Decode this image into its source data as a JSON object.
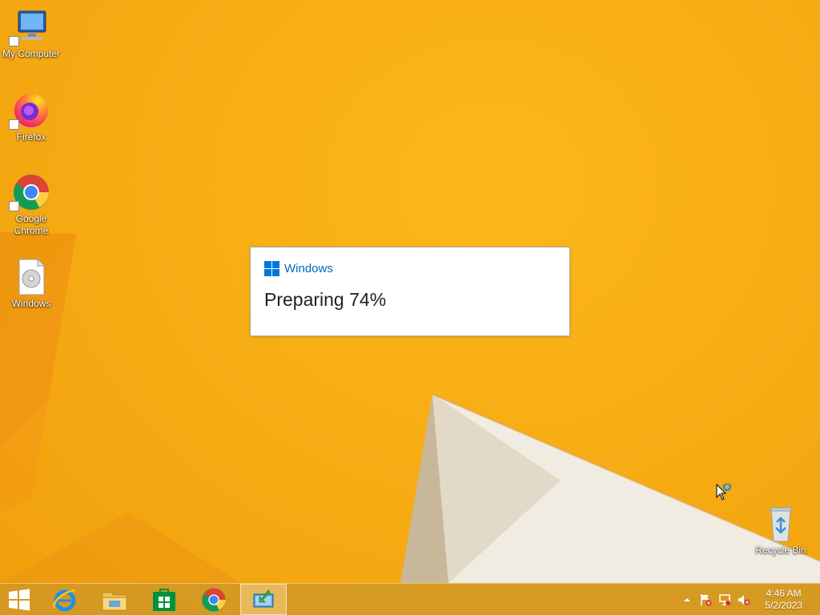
{
  "desktop": {
    "icons": [
      {
        "label": "My Computer",
        "icon": "computer-icon"
      },
      {
        "label": "Firefox",
        "icon": "firefox-icon"
      },
      {
        "label": "Google Chrome",
        "icon": "chrome-icon"
      },
      {
        "label": "Windows",
        "icon": "disc-image-icon"
      },
      {
        "label": "Recycle Bin",
        "icon": "recycle-bin-icon"
      }
    ]
  },
  "dialog": {
    "brand": "Windows",
    "status": "Preparing 74%"
  },
  "taskbar": {
    "buttons": [
      {
        "name": "start-button",
        "icon": "windows-logo-icon"
      },
      {
        "name": "internet-explorer",
        "icon": "internet-explorer-icon"
      },
      {
        "name": "file-explorer",
        "icon": "folder-icon"
      },
      {
        "name": "store",
        "icon": "store-icon"
      },
      {
        "name": "google-chrome",
        "icon": "chrome-icon"
      },
      {
        "name": "setup",
        "icon": "setup-icon",
        "active": true
      }
    ],
    "tray": {
      "icons": [
        "show-hidden-icons-icon",
        "action-center-flag-icon",
        "network-icon",
        "volume-muted-icon"
      ],
      "time": "4:46 AM",
      "date": "5/2/2023"
    }
  },
  "colors": {
    "wallpaper": "#f7ad14",
    "accent": "#0078d7",
    "brand_text": "#0067b8"
  }
}
